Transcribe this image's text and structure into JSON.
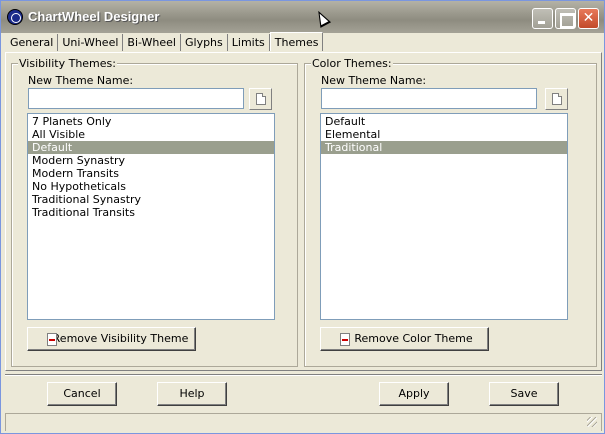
{
  "window": {
    "title": "ChartWheel Designer"
  },
  "tabs": [
    {
      "label": "General",
      "selected": false
    },
    {
      "label": "Uni-Wheel",
      "selected": false
    },
    {
      "label": "Bi-Wheel",
      "selected": false
    },
    {
      "label": "Glyphs",
      "selected": false
    },
    {
      "label": "Limits",
      "selected": false
    },
    {
      "label": "Themes",
      "selected": true
    }
  ],
  "visibility": {
    "group_title": "Visibility Themes:",
    "name_label": "New Theme Name:",
    "name_value": "",
    "items": [
      "7 Planets Only",
      "All Visible",
      "Default",
      "Modern Synastry",
      "Modern Transits",
      "No Hypotheticals",
      "Traditional Synastry",
      "Traditional Transits"
    ],
    "selected": "Default",
    "remove_label": "Remove Visibility Theme"
  },
  "color": {
    "group_title": "Color Themes:",
    "name_label": "New Theme Name:",
    "name_value": "",
    "items": [
      "Default",
      "Elemental",
      "Traditional"
    ],
    "selected": "Traditional",
    "remove_label": "Remove Color Theme"
  },
  "buttons": {
    "cancel": "Cancel",
    "help": "Help",
    "apply": "Apply",
    "save": "Save"
  },
  "icons": {
    "app": "chartwheel-app-icon",
    "new_theme": "new-document-icon",
    "remove": "remove-document-icon"
  },
  "colors": {
    "selection": "#9a9f8e",
    "titlebar": "#9a988c",
    "close": "#c24a2a"
  }
}
